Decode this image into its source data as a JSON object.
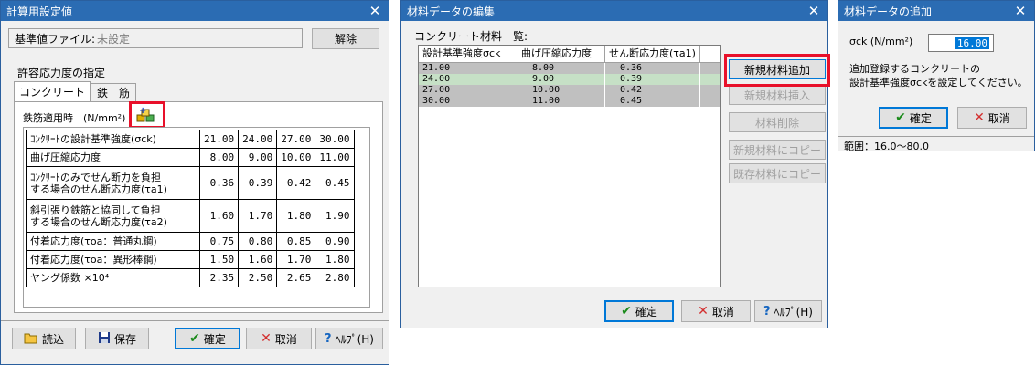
{
  "win1": {
    "title": "計算用設定値",
    "base_file_label": "基準値ファイル:",
    "base_file_value": "未設定",
    "release_button": "解除",
    "allowable_label": "許容応力度の指定",
    "tabs": [
      "コンクリート",
      "鉄　筋"
    ],
    "rebar_label": "鉄筋適用時　(N/mm²)",
    "table": {
      "rows": [
        {
          "label": "ｺﾝｸﾘｰﾄの設計基準強度(σck)",
          "values": [
            "21.00",
            "24.00",
            "27.00",
            "30.00"
          ]
        },
        {
          "label": "曲げ圧縮応力度",
          "values": [
            "8.00",
            "9.00",
            "10.00",
            "11.00"
          ]
        },
        {
          "label": "ｺﾝｸﾘｰﾄのみでせん断力を負担\nする場合のせん断応力度(τa1)",
          "values": [
            "0.36",
            "0.39",
            "0.42",
            "0.45"
          ]
        },
        {
          "label": "斜引張り鉄筋と協同して負担\nする場合のせん断応力度(τa2)",
          "values": [
            "1.60",
            "1.70",
            "1.80",
            "1.90"
          ]
        },
        {
          "label": "付着応力度(τoa：普通丸鋼)",
          "values": [
            "0.75",
            "0.80",
            "0.85",
            "0.90"
          ]
        },
        {
          "label": "付着応力度(τoa：異形棒鋼)",
          "values": [
            "1.50",
            "1.60",
            "1.70",
            "1.80"
          ]
        },
        {
          "label": "ヤング係数 ×10⁴",
          "values": [
            "2.35",
            "2.50",
            "2.65",
            "2.80"
          ]
        }
      ]
    },
    "buttons": {
      "read": "読込",
      "save": "保存",
      "ok": "確定",
      "cancel": "取消",
      "help": "ﾍﾙﾌﾟ(H)"
    }
  },
  "win2": {
    "title": "材料データの編集",
    "list_label": "コンクリート材料一覧:",
    "headers": [
      "設計基準強度σck",
      "曲げ圧縮応力度",
      "せん断応力度(τa1)"
    ],
    "rows": [
      [
        "21.00",
        "8.00",
        "0.36"
      ],
      [
        "24.00",
        "9.00",
        "0.39"
      ],
      [
        "27.00",
        "10.00",
        "0.42"
      ],
      [
        "30.00",
        "11.00",
        "0.45"
      ]
    ],
    "side_buttons": [
      "新規材料追加",
      "新規材料挿入",
      "材料削除",
      "新規材料にコピー",
      "既存材料にコピー"
    ],
    "buttons": {
      "ok": "確定",
      "cancel": "取消",
      "help": "ﾍﾙﾌﾟ(H)"
    }
  },
  "win3": {
    "title": "材料データの追加",
    "sck_label": "σck (N/mm²)",
    "sck_value": "16.00",
    "message_line1": "追加登録するコンクリートの",
    "message_line2": "設計基準強度σckを設定してください。",
    "buttons": {
      "ok": "確定",
      "cancel": "取消"
    },
    "status": "範囲：16.0〜80.0"
  },
  "colors": {
    "titlebar": "#2b6cb3",
    "highlight": "#e8102a",
    "row_gray": "#c0c0c0",
    "row_green": "#c6e0c6"
  }
}
